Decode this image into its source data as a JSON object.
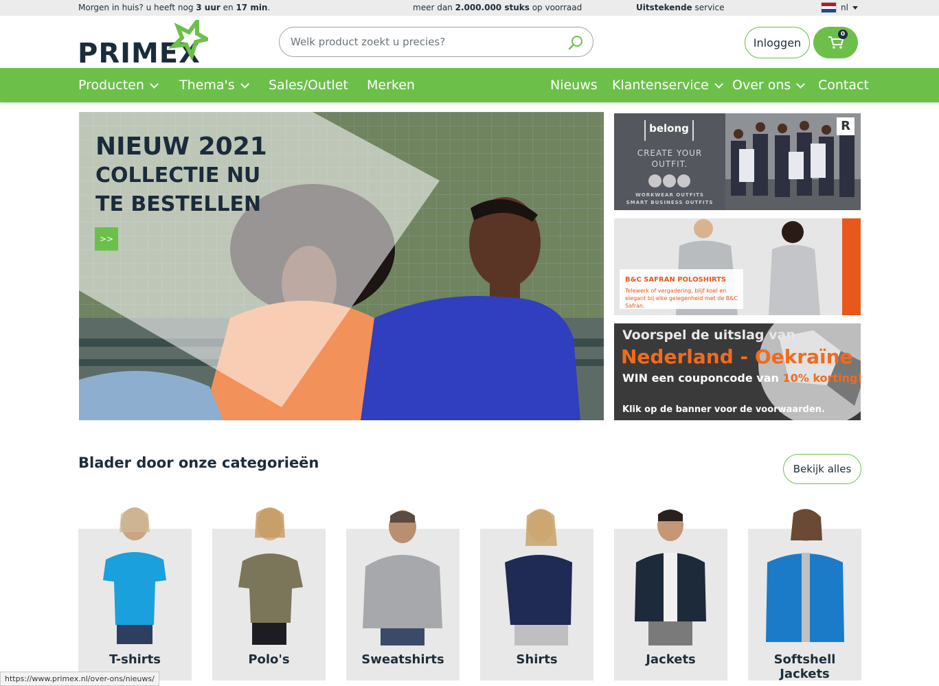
{
  "topbar": {
    "delivery_prefix": "Morgen in huis? u heeft nog ",
    "delivery_hours": "3 uur",
    "delivery_mid": " en ",
    "delivery_min": "17 min",
    "delivery_suffix": ".",
    "stock_prefix": "meer dan ",
    "stock_count": "2.000.000 stuks",
    "stock_suffix": " op voorraad",
    "service_bold": "Uitstekende",
    "service_suffix": " service",
    "language": "nl"
  },
  "header": {
    "logo": "PRIMEX",
    "search_placeholder": "Welk product zoekt u precies?",
    "login_label": "Inloggen",
    "cart_count": "0"
  },
  "nav": {
    "producten": "Producten",
    "themas": "Thema's",
    "sales": "Sales/Outlet",
    "merken": "Merken",
    "nieuws": "Nieuws",
    "klantenservice": "Klantenservice",
    "overons": "Over ons",
    "contact": "Contact"
  },
  "hero": {
    "line1": "NIEUW 2021",
    "line2": "COLLECTIE NU",
    "line3": "TE BESTELLEN",
    "button": ">>"
  },
  "banners": {
    "belong": {
      "brand": "belong",
      "tagline_1": "CREATE YOUR",
      "tagline_2": "OUTFIT.",
      "small_1": "WORKWEAR OUTFITS",
      "small_2": "SMART BUSINESS OUTFITS",
      "badge": "R"
    },
    "safran": {
      "heading": "B&C SAFRAN POLOSHIRTS",
      "body": "Telewerk of vergadering, blijf koel en elegant bij elke gelegenheid met de B&C Safran."
    },
    "match": {
      "line1": "Voorspel de uitslag van",
      "line2": "Nederland - Oekraïne",
      "line3_a": "WIN een couponcode van ",
      "line3_b": "10% korting",
      "line3_c": "!!!",
      "line4": "Klik op de banner voor de voorwaarden."
    }
  },
  "categories": {
    "title": "Blader door onze categorieën",
    "view_all": "Bekijk alles",
    "items": [
      {
        "name": "T-shirts"
      },
      {
        "name": "Polo's"
      },
      {
        "name": "Sweatshirts"
      },
      {
        "name": "Shirts"
      },
      {
        "name": "Jackets"
      },
      {
        "name": "Softshell Jackets"
      }
    ]
  },
  "status_url": "https://www.primex.nl/over-ons/nieuws/",
  "colors": {
    "brand_green": "#6cc04a",
    "navy": "#1d2d3a",
    "orange": "#f26b1d"
  }
}
